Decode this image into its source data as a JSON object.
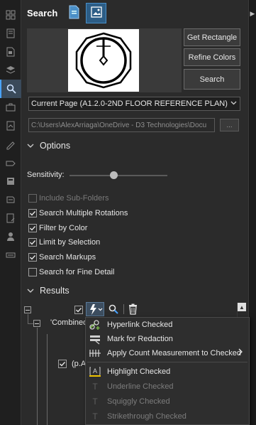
{
  "header": {
    "title": "Search"
  },
  "buttons": {
    "get_rectangle": "Get Rectangle",
    "refine_colors": "Refine Colors",
    "search": "Search"
  },
  "page_select": {
    "value": "Current Page (A1.2.0-2ND FLOOR  REFERENCE PLAN)"
  },
  "folder_path": {
    "value": "C:\\Users\\AlexArriaga\\OneDrive - D3 Technologies\\Docu",
    "browse_label": "..."
  },
  "options": {
    "title": "Options",
    "sensitivity_label": "Sensitivity:",
    "sensitivity_level": 0.45,
    "checkboxes": [
      {
        "label": "Include Sub-Folders",
        "checked": false,
        "enabled": false
      },
      {
        "label": "Search Multiple Rotations",
        "checked": true,
        "enabled": true
      },
      {
        "label": "Filter by Color",
        "checked": true,
        "enabled": true
      },
      {
        "label": "Limit by Selection",
        "checked": true,
        "enabled": true
      },
      {
        "label": "Search Markups",
        "checked": true,
        "enabled": true
      },
      {
        "label": "Search for Fine Detail",
        "checked": false,
        "enabled": true
      }
    ]
  },
  "results": {
    "title": "Results",
    "tree_root": "'Combined",
    "tree_child": "(p.A"
  },
  "context_menu": {
    "items": [
      {
        "label": "Hyperlink Checked",
        "enabled": true,
        "icon": "hyperlink-icon"
      },
      {
        "label": "Mark for Redaction",
        "enabled": true,
        "icon": "redaction-icon"
      },
      {
        "label": "Apply Count Measurement to Checked",
        "enabled": true,
        "icon": "count-measure-icon",
        "submenu": true
      },
      {
        "label": "Highlight Checked",
        "enabled": true,
        "icon": "highlight-icon"
      },
      {
        "label": "Underline Checked",
        "enabled": false,
        "icon": "underline-icon"
      },
      {
        "label": "Squiggly Checked",
        "enabled": false,
        "icon": "squiggly-icon"
      },
      {
        "label": "Strikethrough Checked",
        "enabled": false,
        "icon": "strikethrough-icon"
      }
    ]
  },
  "colors": {
    "accent": "#4aa3ff",
    "selected_tab": "#2c5d86",
    "background": "#2b2b2b",
    "rail": "#1f1f1f"
  }
}
